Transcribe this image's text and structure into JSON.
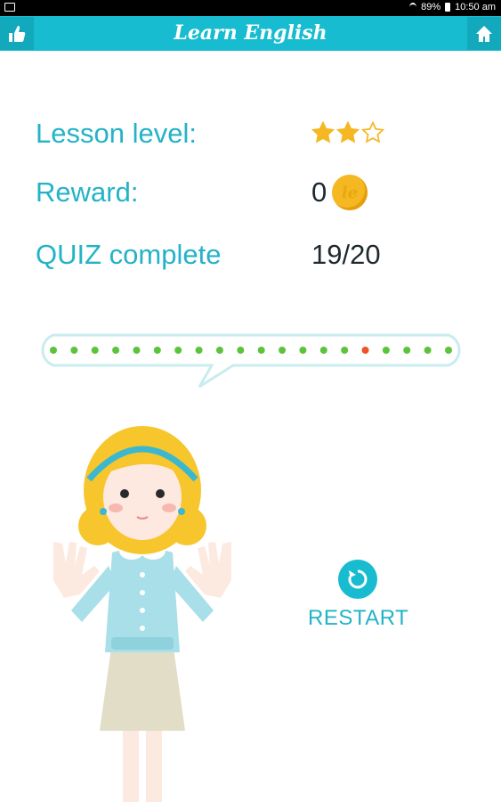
{
  "status_bar": {
    "battery": "89%",
    "time": "10:50 am"
  },
  "appbar": {
    "title": "Learn English",
    "left_icon": "thumbs-up-icon",
    "right_icon": "home-icon"
  },
  "stats": {
    "lesson_level_label": "Lesson level:",
    "lesson_level_stars": 2,
    "lesson_level_max": 3,
    "reward_label": "Reward:",
    "reward_value": "0",
    "coin_glyph": "le",
    "quiz_label": "QUIZ complete",
    "quiz_value": "19/20"
  },
  "progress": {
    "results": [
      "correct",
      "correct",
      "correct",
      "correct",
      "correct",
      "correct",
      "correct",
      "correct",
      "correct",
      "correct",
      "correct",
      "correct",
      "correct",
      "correct",
      "correct",
      "wrong",
      "correct",
      "correct",
      "correct",
      "correct"
    ]
  },
  "restart": {
    "label": "RESTART"
  },
  "colors": {
    "accent": "#17bcd0",
    "correct": "#5bc43b",
    "wrong": "#f0522b",
    "star": "#f5b722"
  }
}
